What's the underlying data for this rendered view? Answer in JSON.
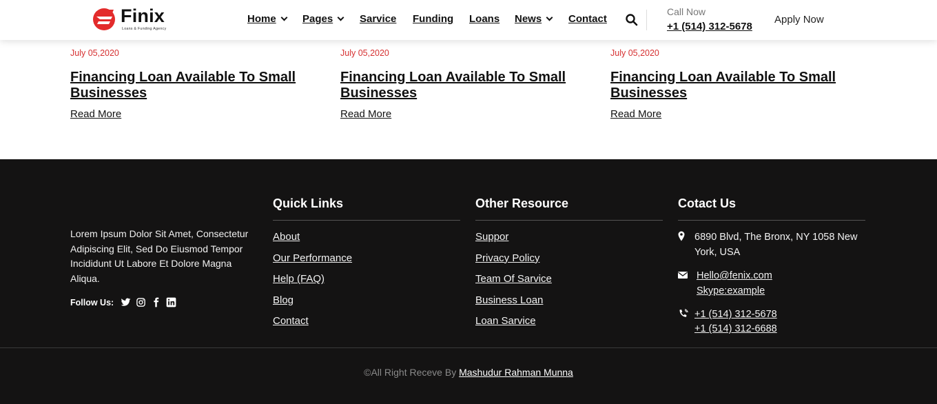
{
  "brand": {
    "name": "Finix",
    "tagline": "Loans & Funding Agency",
    "accent_color": "#e32b2b"
  },
  "nav": {
    "items": [
      {
        "label": "Home",
        "has_dropdown": true
      },
      {
        "label": "Pages",
        "has_dropdown": true
      },
      {
        "label": "Sarvice",
        "has_dropdown": false
      },
      {
        "label": "Funding",
        "has_dropdown": false
      },
      {
        "label": "Loans",
        "has_dropdown": false
      },
      {
        "label": "News",
        "has_dropdown": true
      },
      {
        "label": "Contact",
        "has_dropdown": false
      }
    ],
    "search_icon": "search-icon",
    "call_label": "Call Now",
    "call_number": "+1 (514) 312-5678",
    "apply_label": "Apply Now"
  },
  "posts": [
    {
      "date": "July 05,2020",
      "title": "Financing Loan Available To Small Businesses",
      "read_more": "Read More"
    },
    {
      "date": "July 05,2020",
      "title": "Financing Loan Available To Small Businesses",
      "read_more": "Read More"
    },
    {
      "date": "July 05,2020",
      "title": "Financing Loan Available To Small Businesses",
      "read_more": "Read More"
    }
  ],
  "footer": {
    "about": "Lorem Ipsum Dolor Sit Amet, Consectetur Adipiscing Elit, Sed Do Eiusmod Tempor Incididunt Ut Labore Et Dolore Magna Aliqua.",
    "follow_label": "Follow Us:",
    "social_icons": [
      "twitter-icon",
      "instagram-icon",
      "facebook-icon",
      "linkedin-icon"
    ],
    "quick_links": {
      "title": "Quick Links",
      "items": [
        "About",
        "Our Performance",
        "Help (FAQ)",
        "Blog",
        "Contact"
      ]
    },
    "other_resource": {
      "title": "Other Resource",
      "items": [
        "Suppor",
        "Privacy Policy",
        "Team Of Sarvice",
        "Business Loan",
        "Loan Sarvice"
      ]
    },
    "contact": {
      "title": "Cotact Us",
      "address": "6890 Blvd, The Bronx, NY 1058 New York, USA",
      "email": "Hello@fenix.com",
      "skype": "Skype:example",
      "phone_1": "+1 (514) 312-5678",
      "phone_2": "+1 (514) 312-6688"
    },
    "copyright_prefix": "©All Right Receve By ",
    "copyright_author": "Mashudur Rahman Munna"
  }
}
